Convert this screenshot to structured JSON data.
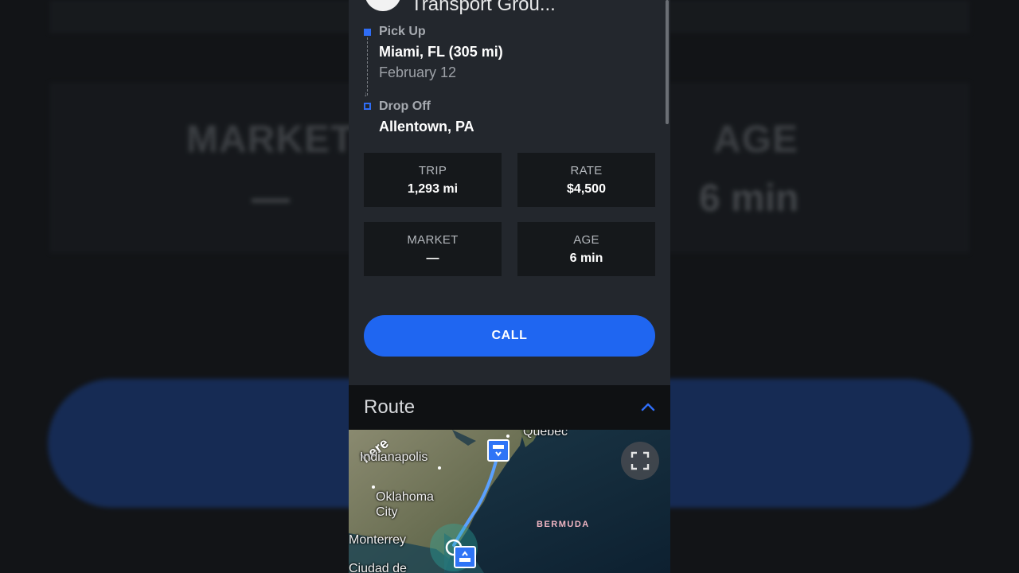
{
  "background": {
    "market_label": "MARKET",
    "market_value": "—",
    "age_label": "AGE",
    "age_value": "6 min"
  },
  "header": {
    "company_name": "Transport Grou..."
  },
  "pickup": {
    "label": "Pick Up",
    "location": "Miami, FL (305 mi)",
    "date": "February 12"
  },
  "dropoff": {
    "label": "Drop Off",
    "location": "Allentown, PA"
  },
  "stats": [
    {
      "label": "TRIP",
      "value": "1,293 mi"
    },
    {
      "label": "RATE",
      "value": "$4,500"
    },
    {
      "label": "MARKET",
      "value": "—"
    },
    {
      "label": "AGE",
      "value": "6 min"
    }
  ],
  "call_button": "CALL",
  "route": {
    "title": "Route",
    "collapse_icon": "chevron-up-icon",
    "fullscreen_icon": "fullscreen-icon",
    "map_labels": {
      "indianapolis": "Indianapolis",
      "oklahoma": "Oklahoma",
      "city": "City",
      "monterrey": "Monterrey",
      "ciudad": "Ciudad de",
      "quebec": "Quebec",
      "bermuda": "BERMUDA"
    },
    "map_logo": "here"
  },
  "colors": {
    "accent": "#1f66f1",
    "panel": "#23272d",
    "card": "#15181b"
  }
}
